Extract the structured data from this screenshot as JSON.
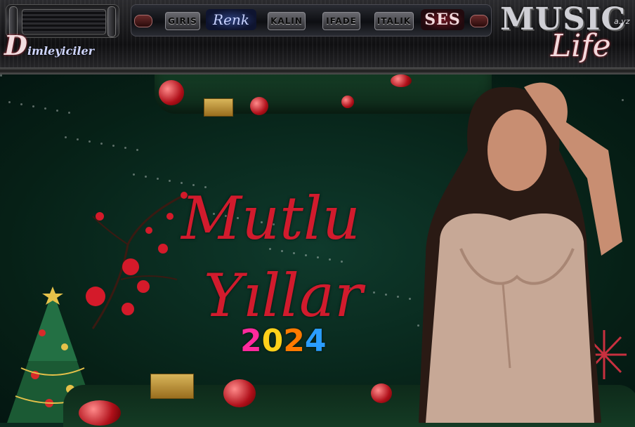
{
  "menu": {
    "items": [
      {
        "id": "giris",
        "label": "GIRIS"
      },
      {
        "id": "renk",
        "label": "Renk"
      },
      {
        "id": "kalin",
        "label": "KALIN"
      },
      {
        "id": "ifade",
        "label": "IFADE"
      },
      {
        "id": "italik",
        "label": "ITALIK"
      },
      {
        "id": "ses",
        "label": "SES"
      }
    ]
  },
  "branding": {
    "left_logo": "D",
    "left_logo_rest": "imleyiciler",
    "right_logo_top": "MUSIC",
    "right_logo_suffix": "a.yz",
    "right_logo_bottom": "Life"
  },
  "scene": {
    "title_line1": "Mutlu",
    "title_line2": "Yıllar",
    "year_digits": [
      "2",
      "0",
      "2",
      "4"
    ]
  },
  "colors": {
    "title_red": "#d11b2d",
    "bg_green": "#0b2a1f",
    "year_colors": [
      "#ff2a9d",
      "#ffd11a",
      "#ff7a00",
      "#2a9dff"
    ]
  }
}
